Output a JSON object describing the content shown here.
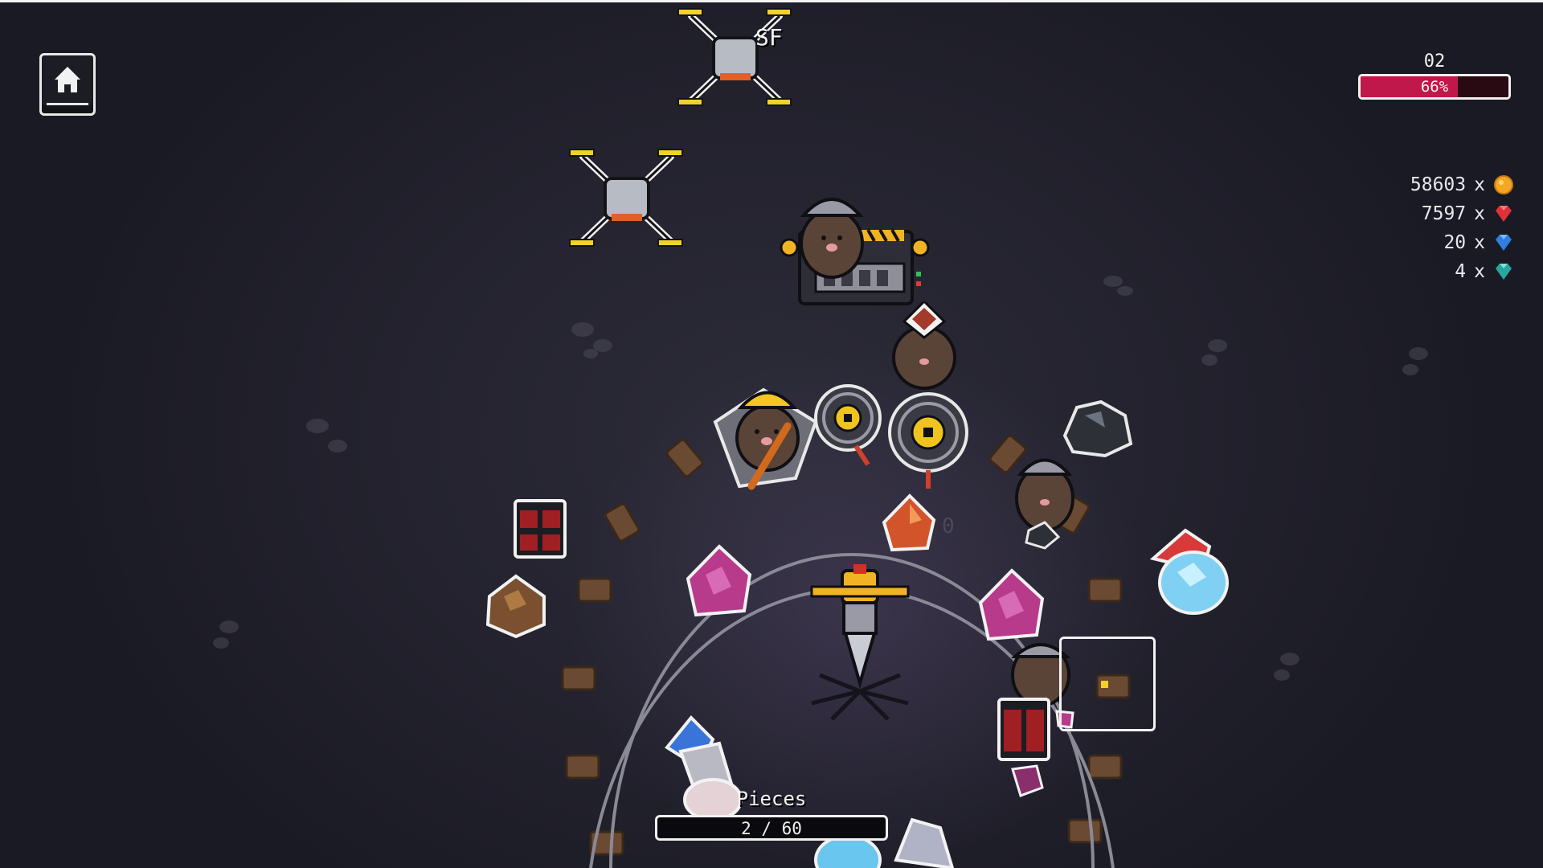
{
  "level": {
    "label": "02",
    "progress_text": "66%",
    "progress_fraction": 0.66
  },
  "resources": [
    {
      "amount": "58603",
      "x": "x",
      "icon": "gold-coin-icon",
      "color": "#f5a623"
    },
    {
      "amount": "7597",
      "x": "x",
      "icon": "red-gem-icon",
      "color": "#e0303a"
    },
    {
      "amount": "20",
      "x": "x",
      "icon": "blue-gem-icon",
      "color": "#2f7fe0"
    },
    {
      "amount": "4",
      "x": "x",
      "icon": "teal-gem-icon",
      "color": "#2aa6a0"
    }
  ],
  "drone_tag": "SF",
  "pieces": {
    "label": "Pieces",
    "count_text": "2 / 60"
  },
  "colors": {
    "progress_fill": "#c0184a",
    "background": "#24232f",
    "helmet_yellow": "#f0b323",
    "rail_wood": "#6a4a33"
  }
}
